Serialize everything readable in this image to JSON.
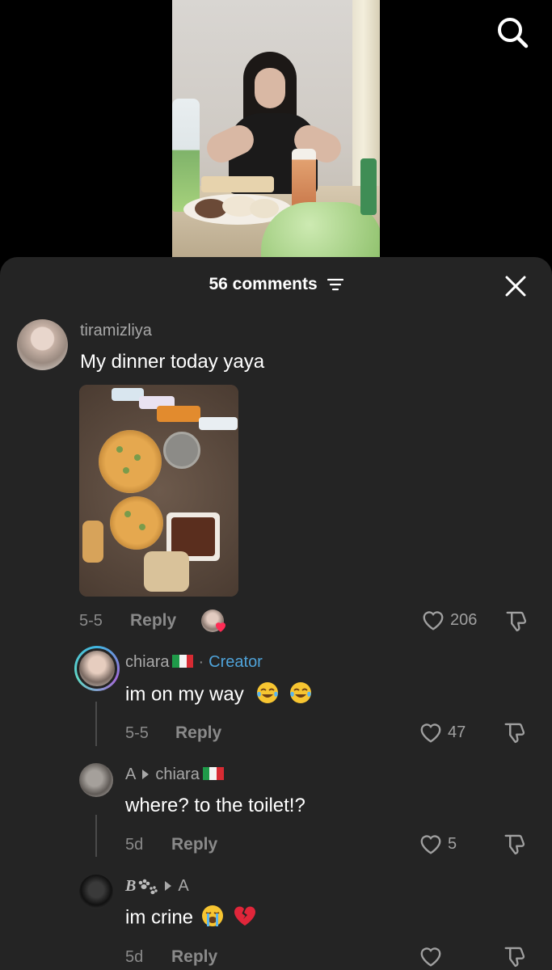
{
  "sheet": {
    "comment_count": "56 comments"
  },
  "comments": [
    {
      "username": "tiramizliya",
      "text": "My dinner today yaya",
      "date": "5-5",
      "reply_label": "Reply",
      "likes": "206"
    },
    {
      "username": "chiara",
      "tag_separator": "·",
      "tag": "Creator",
      "text": "im on my way",
      "date": "5-5",
      "reply_label": "Reply",
      "likes": "47"
    },
    {
      "username": "A",
      "reply_to": "chiara",
      "text": "where? to the toilet!?",
      "date": "5d",
      "reply_label": "Reply",
      "likes": "5"
    },
    {
      "username": "B",
      "reply_to": "A",
      "text": "im crine",
      "date": "5d",
      "reply_label": "Reply",
      "likes": ""
    }
  ],
  "icons": {
    "search": "search-icon",
    "sort": "sort-icon",
    "close": "close-icon",
    "like": "heart-outline-icon",
    "dislike": "thumbs-down-icon",
    "flag": "italy-flag-icon",
    "emoji_laugh": "tears-of-joy-emoji",
    "emoji_cry": "loudly-crying-emoji",
    "emoji_broken_heart": "broken-heart-emoji"
  },
  "colors": {
    "sheet_bg": "#242424",
    "text_primary": "#ffffff",
    "text_secondary": "#8a8a8a",
    "creator_tag": "#4fa3d9",
    "heart_badge": "#fe2c55"
  }
}
